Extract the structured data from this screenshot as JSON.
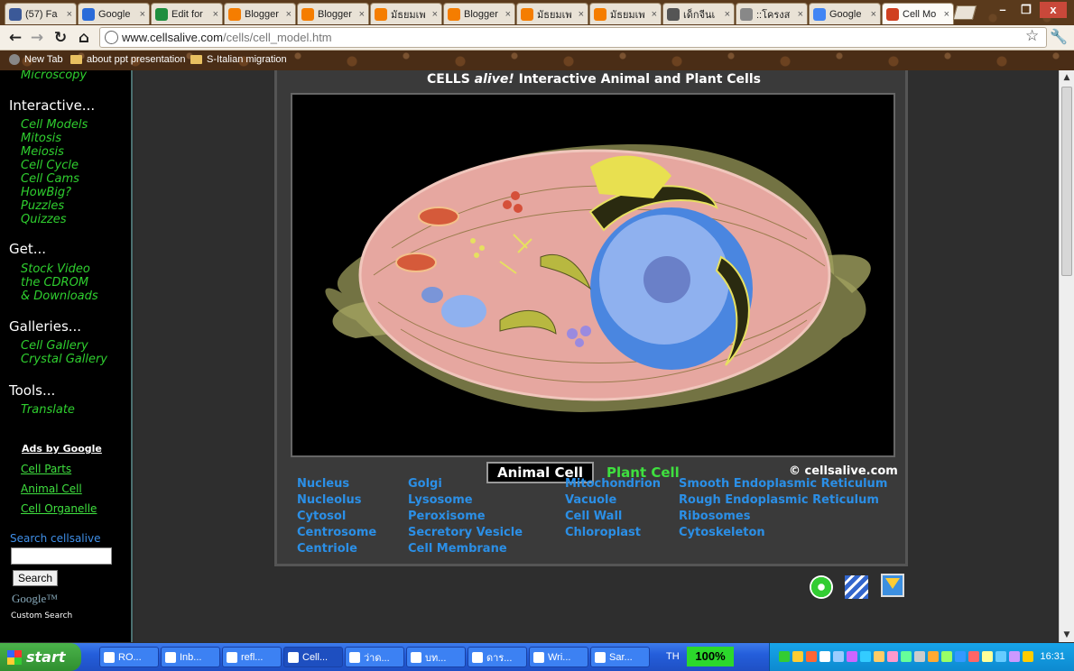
{
  "browser": {
    "tabs": [
      {
        "label": "(57) Fa",
        "icon": "facebook-icon",
        "color": "#3b5998"
      },
      {
        "label": "Google",
        "icon": "google-docs-icon",
        "color": "#2a6bd9"
      },
      {
        "label": "Edit for",
        "icon": "spreadsheet-icon",
        "color": "#1e8e3e"
      },
      {
        "label": "Blogger",
        "icon": "blogger-icon",
        "color": "#f57d00"
      },
      {
        "label": "Blogger",
        "icon": "blogger-icon",
        "color": "#f57d00"
      },
      {
        "label": "มัธยมเพ",
        "icon": "blogger-icon",
        "color": "#f57d00"
      },
      {
        "label": "Blogger",
        "icon": "blogger-icon",
        "color": "#f57d00"
      },
      {
        "label": "มัธยมเพ",
        "icon": "blogger-icon",
        "color": "#f57d00"
      },
      {
        "label": "มัธยมเพ",
        "icon": "blogger-icon",
        "color": "#f57d00"
      },
      {
        "label": "เด็กจีนเ",
        "icon": "image-icon",
        "color": "#555555"
      },
      {
        "label": "::โครงส",
        "icon": "globe-icon",
        "color": "#888888"
      },
      {
        "label": "Google",
        "icon": "google-icon",
        "color": "#4285f4"
      },
      {
        "label": "Cell Mo",
        "icon": "cellsalive-icon",
        "color": "#d04020"
      }
    ],
    "url_domain": "www.cellsalive.com",
    "url_path": "/cells/cell_model.htm",
    "bookmarks": [
      "New Tab",
      "about ppt presentation",
      "S-Italian migration"
    ]
  },
  "sidebar": {
    "top_link": "Microscopy",
    "interactive_heading": "Interactive...",
    "interactive_links": [
      "Cell Models",
      "Mitosis",
      "Meiosis",
      "Cell Cycle",
      "Cell Cams",
      "HowBig?",
      "Puzzles",
      "Quizzes"
    ],
    "get_heading": "Get...",
    "get_links": [
      "Stock Video",
      "the CDROM",
      "& Downloads"
    ],
    "galleries_heading": "Galleries...",
    "galleries_links": [
      "Cell Gallery",
      "Crystal Gallery"
    ],
    "tools_heading": "Tools...",
    "tools_links": [
      "Translate"
    ],
    "ads_heading": "Ads by Google",
    "ads_links": [
      "Cell Parts",
      "Animal Cell",
      "Cell Organelle"
    ],
    "search_label": "Search cellsalive",
    "search_value": "",
    "search_button": "Search",
    "google_logo": "Google™",
    "custom_search": "Custom Search"
  },
  "main": {
    "title_prefix": "CELLS ",
    "title_italic": "alive!",
    "title_suffix": "  Interactive Animal and Plant Cells",
    "tab_animal": "Animal Cell",
    "tab_plant": "Plant Cell",
    "credit": "© cellsalive.com",
    "parts_col1": [
      "Nucleus",
      "Nucleolus",
      "Cytosol",
      "Centrosome",
      "Centriole"
    ],
    "parts_col2": [
      "Golgi",
      "Lysosome",
      "Peroxisome",
      "Secretory Vesicle",
      "Cell Membrane"
    ],
    "parts_col3": [
      "Mitochondrion",
      "Vacuole",
      "Cell Wall",
      "Chloroplast"
    ],
    "parts_col4": [
      "Smooth Endoplasmic Reticulum",
      "Rough Endoplasmic Reticulum",
      "Ribosomes",
      "Cytoskeleton"
    ],
    "colors": {
      "link": "#2b8fe6",
      "green": "#3fe03f"
    }
  },
  "taskbar": {
    "start_label": "start",
    "tasks": [
      "RO...",
      "Inb...",
      "refl...",
      "Cell...",
      "ว่าด...",
      "บท...",
      "ดาร...",
      "Wri...",
      "Sar..."
    ],
    "lang": "TH",
    "zoom": "100%",
    "clock": "16:31"
  }
}
